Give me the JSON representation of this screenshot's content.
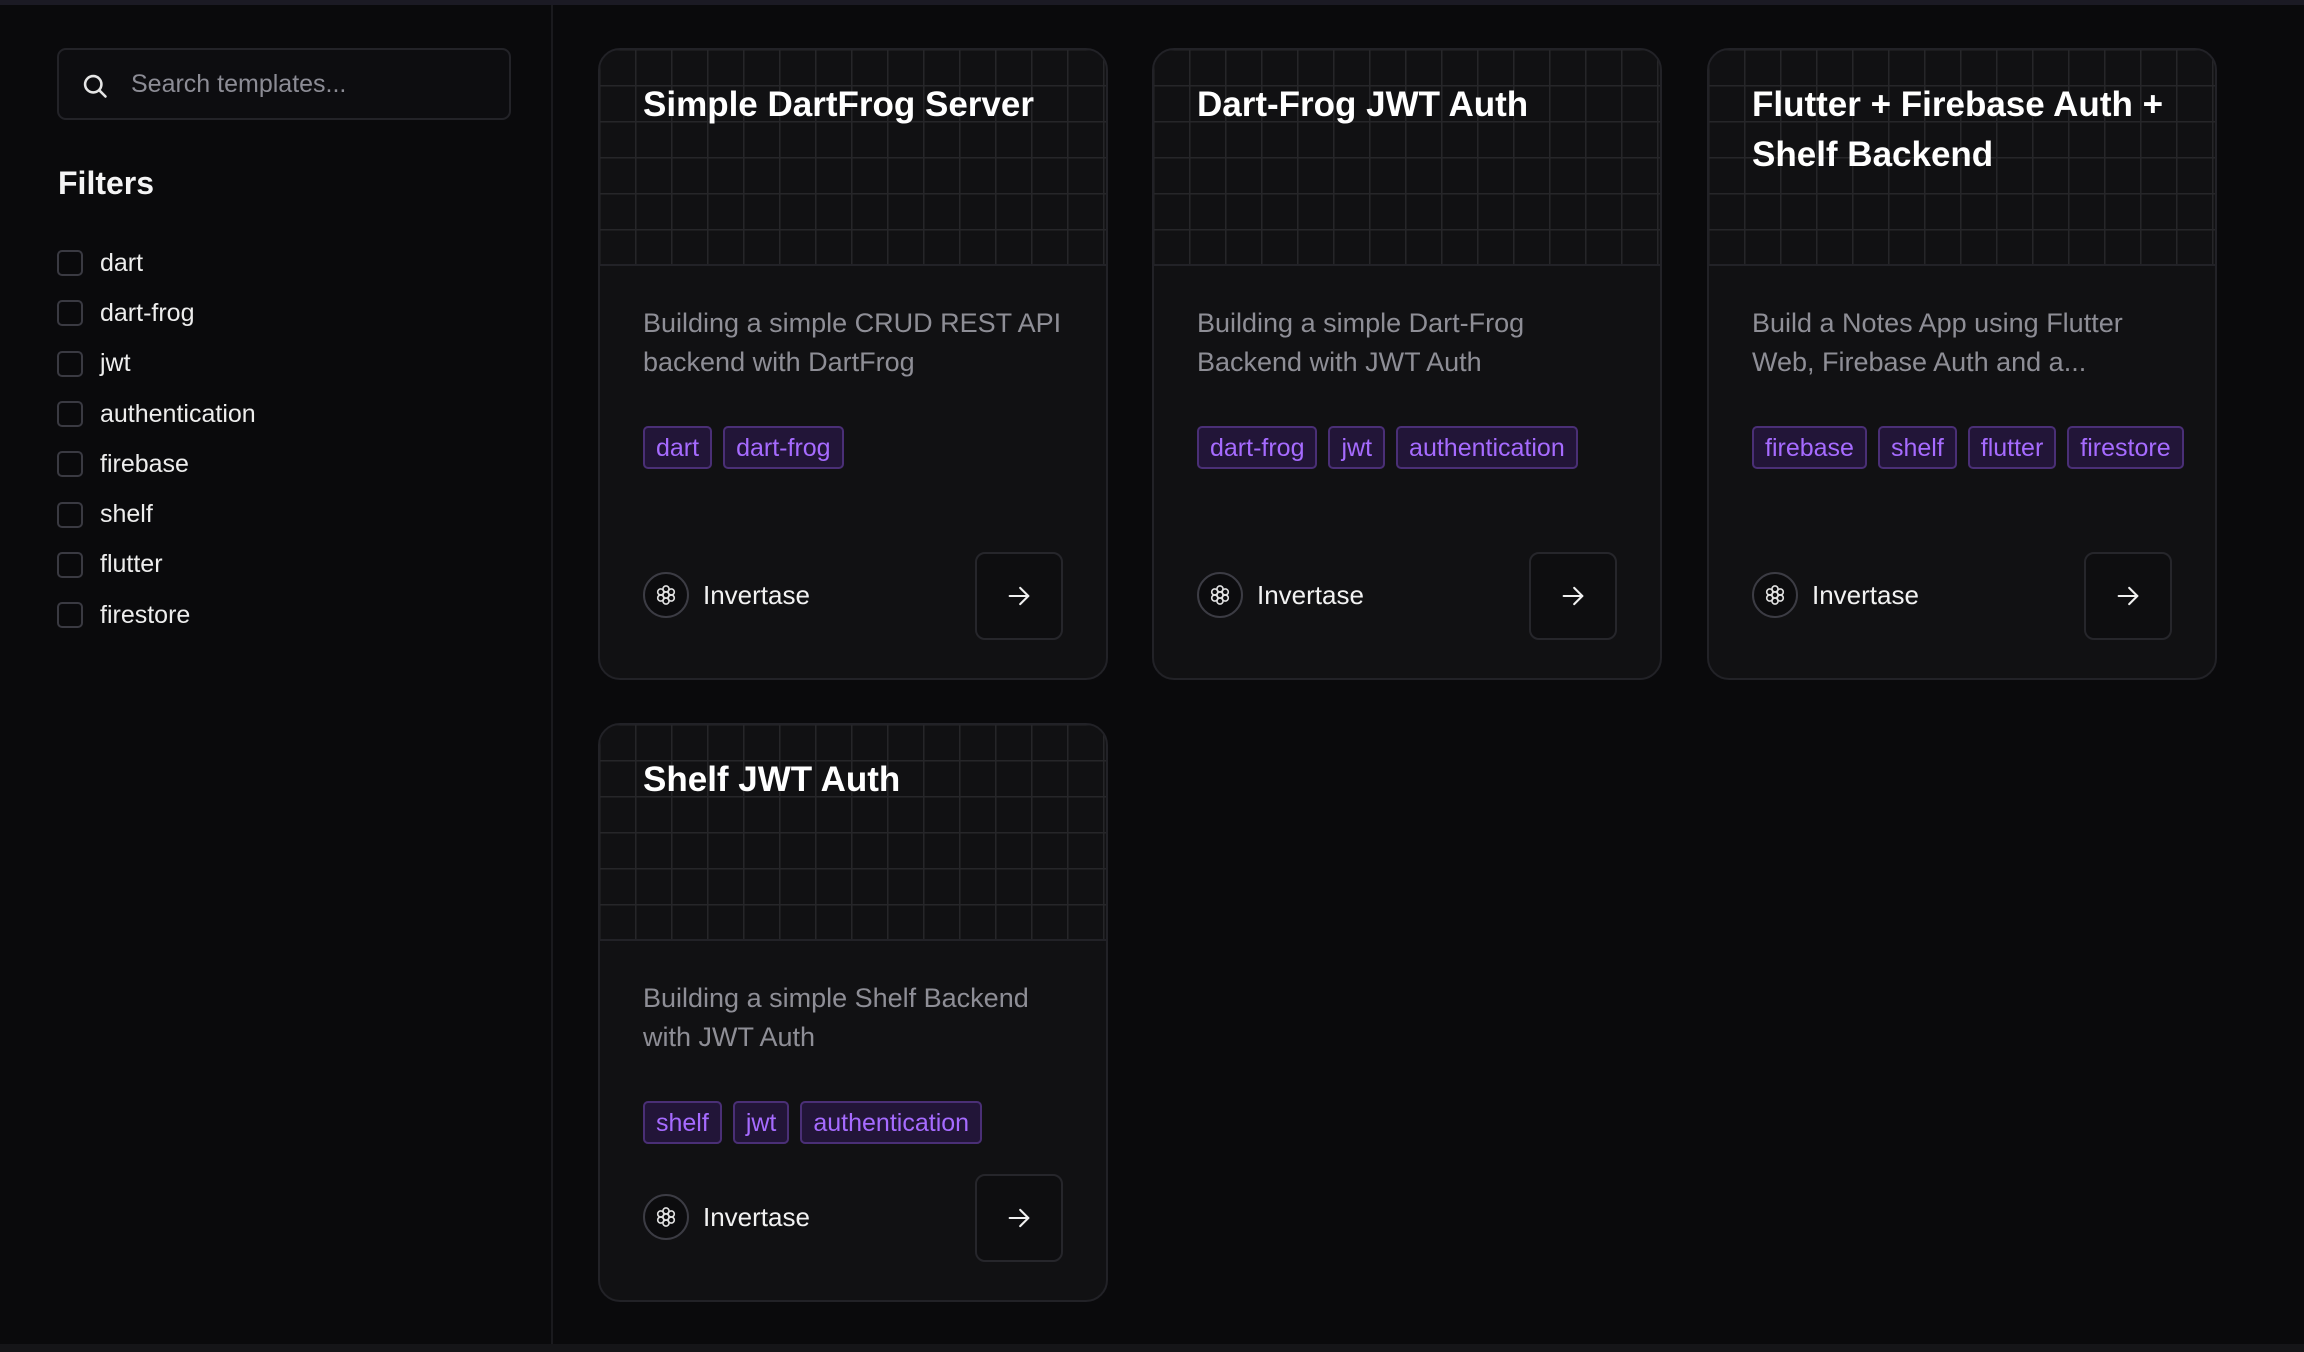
{
  "search": {
    "placeholder": "Search templates...",
    "icon": "search-icon"
  },
  "filters": {
    "title": "Filters",
    "items": [
      {
        "label": "dart",
        "checked": false
      },
      {
        "label": "dart-frog",
        "checked": false
      },
      {
        "label": "jwt",
        "checked": false
      },
      {
        "label": "authentication",
        "checked": false
      },
      {
        "label": "firebase",
        "checked": false
      },
      {
        "label": "shelf",
        "checked": false
      },
      {
        "label": "flutter",
        "checked": false
      },
      {
        "label": "firestore",
        "checked": false
      }
    ]
  },
  "colors": {
    "background": "#0a0a0c",
    "card": "#111113",
    "tag_text": "#a66bff",
    "tag_background": "#221538",
    "tag_border": "#4a2f76"
  },
  "templates": [
    {
      "title": "Simple DartFrog Server",
      "description": "Building a simple CRUD REST API backend with DartFrog",
      "tags": [
        "dart",
        "dart-frog"
      ],
      "author": "Invertase",
      "author_icon": "invertase-logo-icon",
      "action_icon": "arrow-right-icon"
    },
    {
      "title": "Dart-Frog JWT Auth",
      "description": "Building a simple Dart-Frog Backend with JWT Auth",
      "tags": [
        "dart-frog",
        "jwt",
        "authentication"
      ],
      "author": "Invertase",
      "author_icon": "invertase-logo-icon",
      "action_icon": "arrow-right-icon"
    },
    {
      "title": "Flutter + Firebase Auth + Shelf Backend",
      "description": "Build a Notes App using Flutter Web, Firebase Auth and a...",
      "tags": [
        "firebase",
        "shelf",
        "flutter",
        "firestore"
      ],
      "author": "Invertase",
      "author_icon": "invertase-logo-icon",
      "action_icon": "arrow-right-icon"
    },
    {
      "title": "Shelf JWT Auth",
      "description": "Building a simple Shelf Backend with JWT Auth",
      "tags": [
        "shelf",
        "jwt",
        "authentication"
      ],
      "author": "Invertase",
      "author_icon": "invertase-logo-icon",
      "action_icon": "arrow-right-icon"
    }
  ]
}
